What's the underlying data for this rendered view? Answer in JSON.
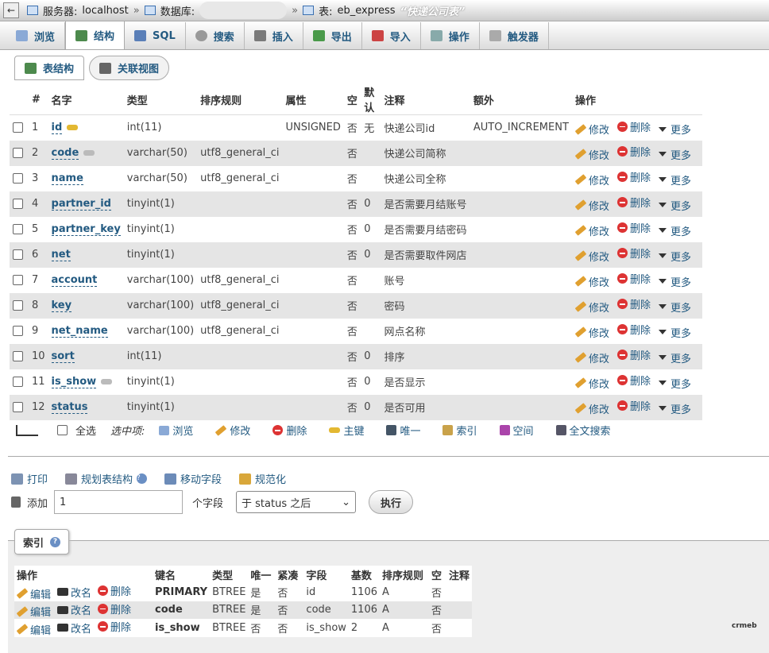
{
  "breadcrumb": {
    "server_label": "服务器:",
    "server": "localhost",
    "db_label": "数据库:",
    "table_label": "表:",
    "table": "eb_express",
    "table_comment": "“快递公司表”"
  },
  "tabs": [
    {
      "label": "浏览",
      "icon": "browse-icon"
    },
    {
      "label": "结构",
      "icon": "structure-icon"
    },
    {
      "label": "SQL",
      "icon": "sql-icon"
    },
    {
      "label": "搜索",
      "icon": "search-icon"
    },
    {
      "label": "插入",
      "icon": "insert-icon"
    },
    {
      "label": "导出",
      "icon": "export-icon"
    },
    {
      "label": "导入",
      "icon": "import-icon"
    },
    {
      "label": "操作",
      "icon": "wrench-icon"
    },
    {
      "label": "触发器",
      "icon": "trigger-icon"
    }
  ],
  "subtabs": {
    "structure": "表结构",
    "relation": "关联视图"
  },
  "columns": [
    "#",
    "名字",
    "类型",
    "排序规则",
    "属性",
    "空",
    "默认",
    "注释",
    "额外",
    "操作"
  ],
  "row_actions": {
    "edit": "修改",
    "delete": "删除",
    "more": "更多"
  },
  "rows": [
    {
      "n": "1",
      "name": "id",
      "type": "int(11)",
      "coll": "",
      "attr": "UNSIGNED",
      "null": "否",
      "def": "无",
      "comment": "快递公司id",
      "extra": "AUTO_INCREMENT"
    },
    {
      "n": "2",
      "name": "code",
      "type": "varchar(50)",
      "coll": "utf8_general_ci",
      "attr": "",
      "null": "否",
      "def": "",
      "comment": "快递公司简称",
      "extra": ""
    },
    {
      "n": "3",
      "name": "name",
      "type": "varchar(50)",
      "coll": "utf8_general_ci",
      "attr": "",
      "null": "否",
      "def": "",
      "comment": "快递公司全称",
      "extra": ""
    },
    {
      "n": "4",
      "name": "partner_id",
      "type": "tinyint(1)",
      "coll": "",
      "attr": "",
      "null": "否",
      "def": "0",
      "comment": "是否需要月结账号",
      "extra": ""
    },
    {
      "n": "5",
      "name": "partner_key",
      "type": "tinyint(1)",
      "coll": "",
      "attr": "",
      "null": "否",
      "def": "0",
      "comment": "是否需要月结密码",
      "extra": ""
    },
    {
      "n": "6",
      "name": "net",
      "type": "tinyint(1)",
      "coll": "",
      "attr": "",
      "null": "否",
      "def": "0",
      "comment": "是否需要取件网店",
      "extra": ""
    },
    {
      "n": "7",
      "name": "account",
      "type": "varchar(100)",
      "coll": "utf8_general_ci",
      "attr": "",
      "null": "否",
      "def": "",
      "comment": "账号",
      "extra": ""
    },
    {
      "n": "8",
      "name": "key",
      "type": "varchar(100)",
      "coll": "utf8_general_ci",
      "attr": "",
      "null": "否",
      "def": "",
      "comment": "密码",
      "extra": ""
    },
    {
      "n": "9",
      "name": "net_name",
      "type": "varchar(100)",
      "coll": "utf8_general_ci",
      "attr": "",
      "null": "否",
      "def": "",
      "comment": "网点名称",
      "extra": ""
    },
    {
      "n": "10",
      "name": "sort",
      "type": "int(11)",
      "coll": "",
      "attr": "",
      "null": "否",
      "def": "0",
      "comment": "排序",
      "extra": ""
    },
    {
      "n": "11",
      "name": "is_show",
      "type": "tinyint(1)",
      "coll": "",
      "attr": "",
      "null": "否",
      "def": "0",
      "comment": "是否显示",
      "extra": ""
    },
    {
      "n": "12",
      "name": "status",
      "type": "tinyint(1)",
      "coll": "",
      "attr": "",
      "null": "否",
      "def": "0",
      "comment": "是否可用",
      "extra": ""
    }
  ],
  "bulk": {
    "check_all": "全选",
    "with_selected": "选中项:",
    "browse": "浏览",
    "edit": "修改",
    "delete": "删除",
    "primary": "主键",
    "unique": "唯一",
    "index": "索引",
    "spatial": "空间",
    "fulltext": "全文搜索"
  },
  "tools": {
    "print": "打印",
    "propose": "规划表结构",
    "move": "移动字段",
    "normalize": "规范化"
  },
  "add": {
    "label": "添加",
    "count": "1",
    "unit": "个字段",
    "position": "于 status 之后",
    "go": "执行"
  },
  "indexes": {
    "legend": "索引",
    "columns": [
      "操作",
      "键名",
      "类型",
      "唯一",
      "紧凑",
      "字段",
      "基数",
      "排序规则",
      "空",
      "注释"
    ],
    "actions": {
      "edit": "编辑",
      "rename": "改名",
      "delete": "删除"
    },
    "rows": [
      {
        "key": "PRIMARY",
        "type": "BTREE",
        "unique": "是",
        "packed": "否",
        "field": "id",
        "card": "1106",
        "coll": "A",
        "null": "否",
        "comment": ""
      },
      {
        "key": "code",
        "type": "BTREE",
        "unique": "是",
        "packed": "否",
        "field": "code",
        "card": "1106",
        "coll": "A",
        "null": "否",
        "comment": ""
      },
      {
        "key": "is_show",
        "type": "BTREE",
        "unique": "否",
        "packed": "否",
        "field": "is_show",
        "card": "2",
        "coll": "A",
        "null": "否",
        "comment": ""
      }
    ]
  },
  "watermark": "crmeb"
}
